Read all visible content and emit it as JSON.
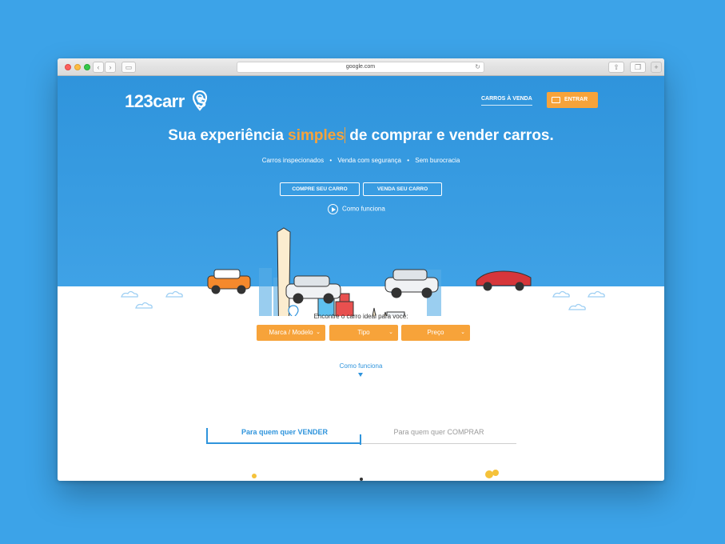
{
  "browser": {
    "url": "google.com"
  },
  "header": {
    "logo_text": "123carr",
    "logo_suffix": "s",
    "nav_link": "CARROS À VENDA",
    "login_label": "ENTRAR"
  },
  "hero": {
    "headline_before": "Sua experiência ",
    "headline_accent": "simples",
    "headline_after": " de comprar e vender carros.",
    "features": [
      "Carros inspecionados",
      "Venda com segurança",
      "Sem burocracia"
    ],
    "buy_button": "COMPRE SEU CARRO",
    "sell_button": "VENDA SEU CARRO",
    "how_it_works": "Como funciona"
  },
  "finder": {
    "label": "Encontre o carro ideal para você:",
    "dropdowns": [
      "Marca / Modelo",
      "Tipo",
      "Preço"
    ]
  },
  "how_link": "Como funciona",
  "tabs": {
    "sell": "Para quem quer VENDER",
    "buy": "Para quem quer COMPRAR"
  },
  "colors": {
    "background": "#3ca3e8",
    "hero": "#2f94dc",
    "accent": "#f7a33a"
  }
}
